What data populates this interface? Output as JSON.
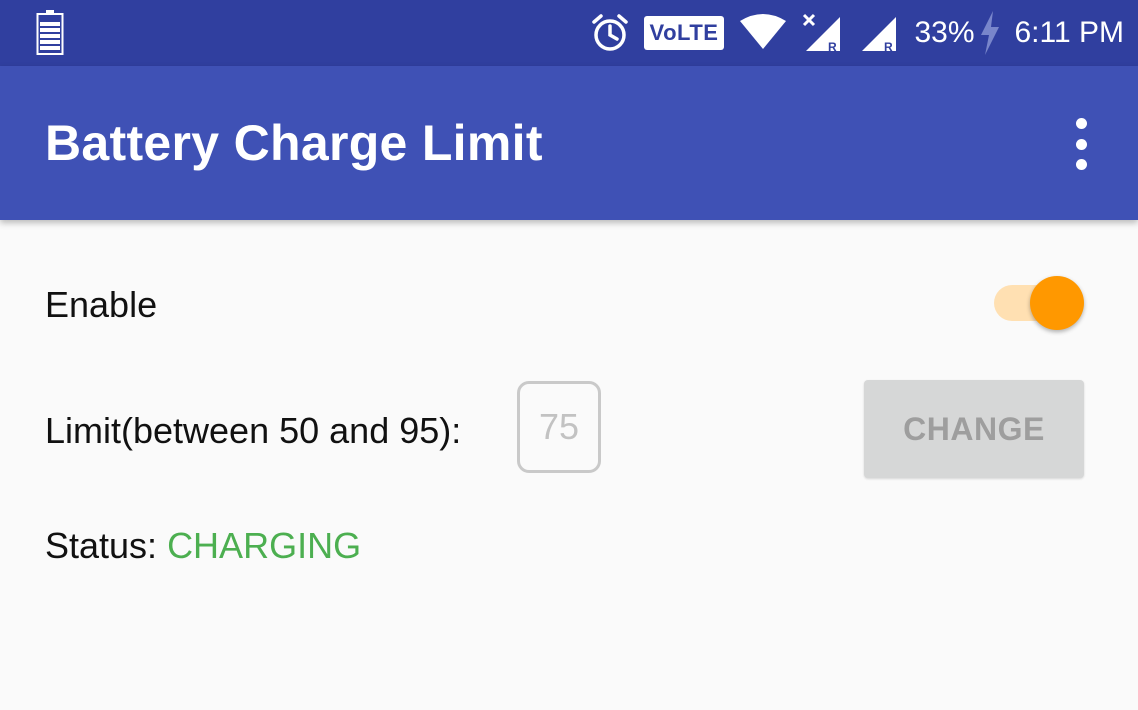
{
  "status_bar": {
    "battery_percent": "33%",
    "time": "6:11 PM",
    "volte_label": "VoLTE",
    "icons": [
      "battery-small-icon",
      "alarm-icon",
      "volte-icon",
      "wifi-icon",
      "signal-1-icon",
      "signal-2-icon",
      "charging-bolt-icon"
    ]
  },
  "app_bar": {
    "title": "Battery Charge Limit",
    "overflow_icon": "more-vert-icon"
  },
  "settings": {
    "enable_label": "Enable",
    "enable_on": true,
    "limit_label": "Limit(between 50 and 95):",
    "limit_value": "75",
    "change_button_label": "CHANGE",
    "status_label": "Status: ",
    "status_value": "CHARGING"
  },
  "colors": {
    "status_bar": "#303f9f",
    "app_bar": "#3f51b5",
    "accent": "#ff9800",
    "status_ok": "#4caf50"
  }
}
